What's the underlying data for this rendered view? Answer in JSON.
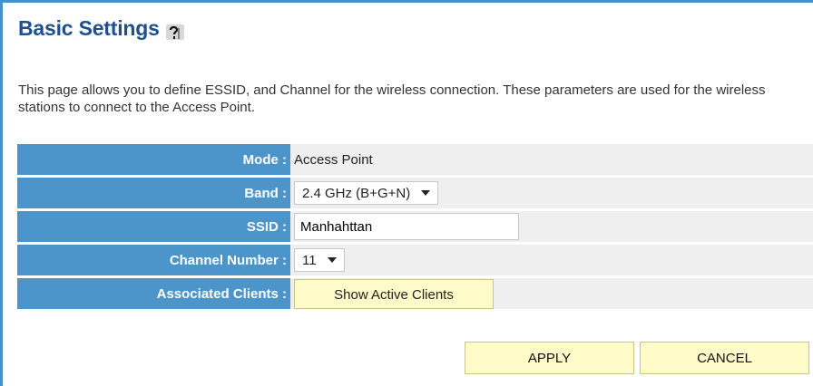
{
  "page": {
    "title": "Basic Settings",
    "help_icon": "help-icon"
  },
  "description": "This page allows you to define ESSID, and Channel for the wireless connection. These parameters are used for the wireless stations to connect to the Access Point.",
  "fields": {
    "mode": {
      "label": "Mode :",
      "value": "Access Point"
    },
    "band": {
      "label": "Band :",
      "value": "2.4 GHz (B+G+N)"
    },
    "ssid": {
      "label": "SSID :",
      "value": "Manhahttan"
    },
    "channel": {
      "label": "Channel Number :",
      "value": "11"
    },
    "clients": {
      "label": "Associated Clients :",
      "button": "Show Active Clients"
    }
  },
  "actions": {
    "apply": "APPLY",
    "cancel": "CANCEL"
  },
  "colors": {
    "label_bg": "#4b95cb",
    "title": "#1e4f8e",
    "button_bg": "#fffbc8",
    "row_bg": "#efefef"
  }
}
